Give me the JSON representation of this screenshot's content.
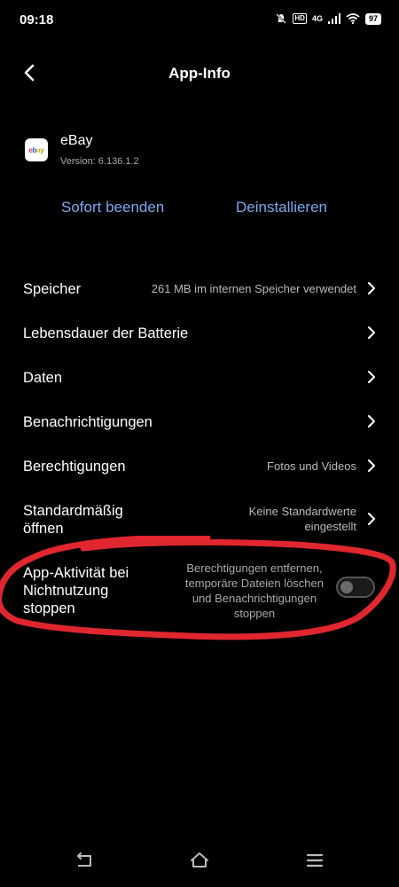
{
  "status": {
    "time": "09:18",
    "hd": "HD",
    "network": "4G",
    "battery": "97"
  },
  "header": {
    "title": "App-Info"
  },
  "app": {
    "name": "eBay",
    "version": "Version: 6.136.1.2",
    "icon_text": "ebay"
  },
  "actions": {
    "force_stop": "Sofort beenden",
    "uninstall": "Deinstallieren"
  },
  "settings": [
    {
      "label": "Speicher",
      "value": "261 MB im internen Speicher verwendet"
    },
    {
      "label": "Lebensdauer der Batterie",
      "value": ""
    },
    {
      "label": "Daten",
      "value": ""
    },
    {
      "label": "Benachrichtigungen",
      "value": ""
    },
    {
      "label": "Berechtigungen",
      "value": "Fotos und Videos"
    },
    {
      "label_line1": "Standardmäßig",
      "label_line2": "öffnen",
      "value_line1": "Keine Standardwerte",
      "value_line2": "eingestellt"
    }
  ],
  "pause_activity": {
    "label_line1": "App-Aktivität bei",
    "label_line2": "Nichtnutzung",
    "label_line3": "stoppen",
    "desc_line1": "Berechtigungen entfernen,",
    "desc_line2": "temporäre Dateien löschen",
    "desc_line3": "und Benachrichtigungen",
    "desc_line4": "stoppen",
    "enabled": false
  },
  "colors": {
    "accent": "#7ea7ee",
    "highlight": "#e0262e"
  }
}
